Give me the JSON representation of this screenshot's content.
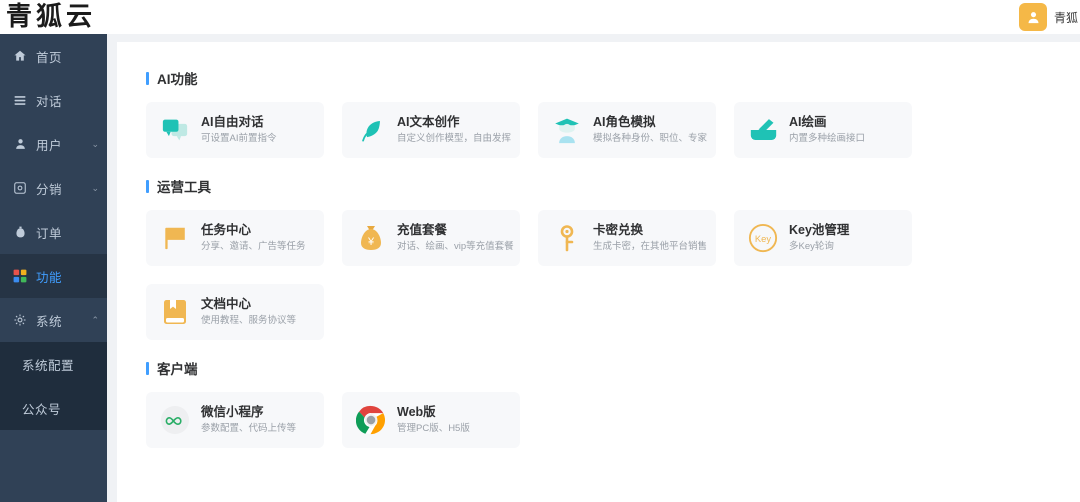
{
  "brand": {
    "logo_text": "青狐云"
  },
  "topbar": {
    "avatar_icon": "user-avatar-icon",
    "username": "青狐"
  },
  "sidebar": {
    "items": [
      {
        "label": "首页",
        "icon": "home-icon",
        "expandable": false,
        "active": false
      },
      {
        "label": "对话",
        "icon": "chat-list-icon",
        "expandable": false,
        "active": false
      },
      {
        "label": "用户",
        "icon": "user-icon",
        "expandable": true,
        "arrow": "⌄",
        "active": false
      },
      {
        "label": "分销",
        "icon": "distribution-icon",
        "expandable": true,
        "arrow": "⌄",
        "active": false
      },
      {
        "label": "订单",
        "icon": "order-icon",
        "expandable": false,
        "active": false
      },
      {
        "label": "功能",
        "icon": "grid-apps-icon",
        "expandable": false,
        "active": true
      },
      {
        "label": "系统",
        "icon": "gear-icon",
        "expandable": true,
        "arrow": "⌃",
        "active": false
      }
    ],
    "submenu": [
      {
        "label": "系统配置"
      },
      {
        "label": "公众号"
      }
    ]
  },
  "main": {
    "sections": [
      {
        "title": "AI功能",
        "cards": [
          {
            "title": "AI自由对话",
            "subtitle": "可设置AI前置指令",
            "icon": "chat-bubble-icon",
            "color": "#1fc2b5"
          },
          {
            "title": "AI文本创作",
            "subtitle": "自定义创作模型，自由发挥",
            "icon": "feather-pen-icon",
            "color": "#1fc2b5"
          },
          {
            "title": "AI角色模拟",
            "subtitle": "模拟各种身份、职位、专家",
            "icon": "graduate-person-icon",
            "color": "#1fc2b5"
          },
          {
            "title": "AI绘画",
            "subtitle": "内置多种绘画接口",
            "icon": "paint-brush-icon",
            "color": "#1fc2b5"
          }
        ]
      },
      {
        "title": "运营工具",
        "cards": [
          {
            "title": "任务中心",
            "subtitle": "分享、邀请、广告等任务",
            "icon": "flag-icon",
            "color": "#f0b752"
          },
          {
            "title": "充值套餐",
            "subtitle": "对话、绘画、vip等充值套餐",
            "icon": "money-bag-icon",
            "color": "#f0b752"
          },
          {
            "title": "卡密兑换",
            "subtitle": "生成卡密，在其他平台销售",
            "icon": "key-icon",
            "color": "#f0b752"
          },
          {
            "title": "Key池管理",
            "subtitle": "多Key轮询",
            "icon": "key-pool-icon",
            "color": "#f0b752"
          },
          {
            "title": "文档中心",
            "subtitle": "使用教程、服务协议等",
            "icon": "book-icon",
            "color": "#f0b752"
          }
        ]
      },
      {
        "title": "客户端",
        "cards": [
          {
            "title": "微信小程序",
            "subtitle": "参数配置、代码上传等",
            "icon": "wechat-miniprogram-icon",
            "color": "#2aae67"
          },
          {
            "title": "Web版",
            "subtitle": "管理PC版、H5版",
            "icon": "chrome-browser-icon",
            "color": "#4285f4"
          }
        ]
      }
    ]
  },
  "colors": {
    "sidebar_bg": "#304156",
    "sidebar_active_bg": "#263445",
    "submenu_bg": "#1f2d3d",
    "accent_blue": "#409eff",
    "page_bg": "#f0f2f5",
    "card_bg": "#f7f8fa",
    "teal": "#1fc2b5",
    "orange": "#f0b752",
    "avatar_yellow": "#f5b847"
  }
}
